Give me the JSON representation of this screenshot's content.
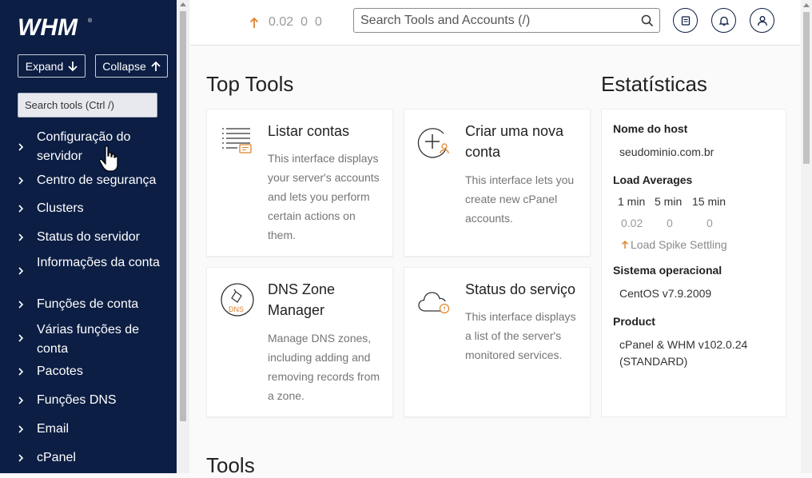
{
  "sidebar": {
    "logo_text": "WHM",
    "expand_label": "Expand",
    "collapse_label": "Collapse",
    "search_placeholder": "Search tools (Ctrl /)",
    "items": [
      {
        "label": "Configuração do servidor"
      },
      {
        "label": "Centro de segurança"
      },
      {
        "label": "Clusters"
      },
      {
        "label": "Status do servidor"
      },
      {
        "label": "Informações da conta"
      },
      {
        "label": "Funções de conta"
      },
      {
        "label": "Várias funções de conta"
      },
      {
        "label": "Pacotes"
      },
      {
        "label": "Funções DNS"
      },
      {
        "label": "Email"
      },
      {
        "label": "cPanel"
      }
    ]
  },
  "header": {
    "load": [
      "0.02",
      "0",
      "0"
    ],
    "search_placeholder": "Search Tools and Accounts (/)",
    "icons": [
      "notes-icon",
      "bell-icon",
      "user-icon"
    ]
  },
  "main": {
    "top_tools_title": "Top Tools",
    "tools_title": "Tools",
    "cards": [
      {
        "title": "Listar contas",
        "desc": "This interface displays your server's accounts and lets you perform certain actions on them.",
        "icon": "list-accounts-icon"
      },
      {
        "title": "Criar uma nova conta",
        "desc": "This interface lets you create new cPanel accounts.",
        "icon": "create-account-icon"
      },
      {
        "title": "DNS Zone Manager",
        "desc": "Manage DNS zones, including adding and removing records from a zone.",
        "icon": "dns-icon",
        "icon_text": "DNS"
      },
      {
        "title": "Status do serviço",
        "desc": "This interface displays a list of the server's monitored services.",
        "icon": "cloud-status-icon"
      }
    ]
  },
  "stats": {
    "title": "Estatísticas",
    "hostname_label": "Nome do host",
    "hostname": "seudominio.com.br",
    "load_label": "Load Averages",
    "load_headers": [
      "1 min",
      "5 min",
      "15 min"
    ],
    "load_values": [
      "0.02",
      "0",
      "0"
    ],
    "spike": "Load Spike Settling",
    "os_label": "Sistema operacional",
    "os": "CentOS v7.9.2009",
    "product_label": "Product",
    "product": "cPanel & WHM v102.0.24 (STANDARD)"
  },
  "colors": {
    "sidebar_bg": "#0c1e44",
    "accent_orange": "#e0822a",
    "text_muted": "#757575"
  }
}
